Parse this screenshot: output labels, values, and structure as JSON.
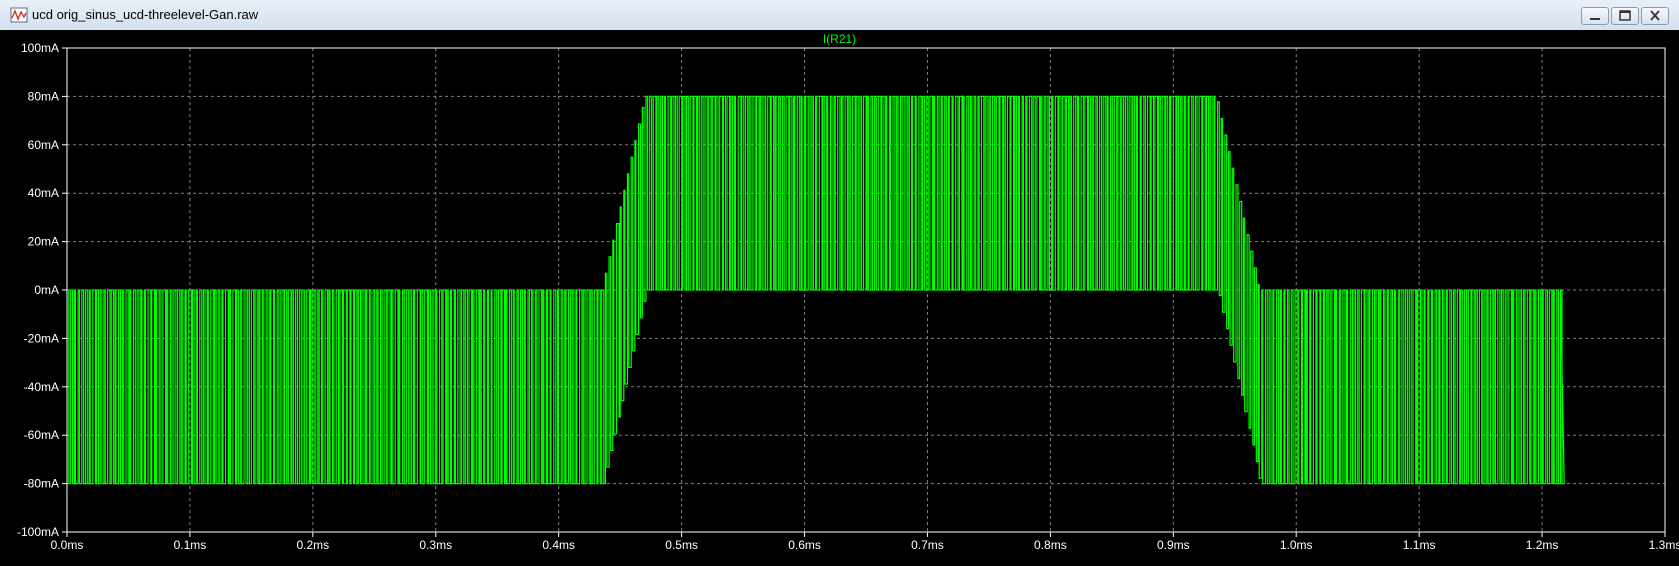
{
  "window": {
    "title": "ucd orig_sinus_ucd-threelevel-Gan.raw",
    "icon": "waveform-viewer-icon",
    "buttons": [
      "minimize-icon",
      "maximize-icon",
      "close-icon"
    ]
  },
  "colors": {
    "background": "#000000",
    "trace": "#00ff00",
    "grid": "#808080",
    "axis_text": "#ffffff"
  },
  "chart_data": {
    "type": "line",
    "title": "I(R21)",
    "xlabel": "",
    "ylabel": "",
    "xlim": [
      0.0,
      1.3
    ],
    "ylim": [
      -100,
      100
    ],
    "grid": true,
    "x_ticks": [
      "0.0ms",
      "0.1ms",
      "0.2ms",
      "0.3ms",
      "0.4ms",
      "0.5ms",
      "0.6ms",
      "0.7ms",
      "0.8ms",
      "0.9ms",
      "1.0ms",
      "1.1ms",
      "1.2ms",
      "1.3ms"
    ],
    "y_ticks": [
      "100mA",
      "80mA",
      "60mA",
      "40mA",
      "20mA",
      "0mA",
      "-20mA",
      "-40mA",
      "-60mA",
      "-80mA",
      "-100mA"
    ],
    "series": [
      {
        "name": "I(R21)",
        "unit_x": "ms",
        "unit_y": "mA",
        "description_segments": [
          {
            "x": [
              0.0,
              0.435
            ],
            "low": -80,
            "high": 0
          },
          {
            "x": [
              0.435,
              0.47
            ],
            "low": -80,
            "high": 80
          },
          {
            "x": [
              0.47,
              0.935
            ],
            "low": 0,
            "high": 80
          },
          {
            "x": [
              0.935,
              0.97
            ],
            "low": -80,
            "high": 80
          },
          {
            "x": [
              0.97,
              1.215
            ],
            "low": -80,
            "high": 0
          }
        ],
        "pulse_period_ms": 0.003,
        "x_end": 1.215
      }
    ]
  }
}
